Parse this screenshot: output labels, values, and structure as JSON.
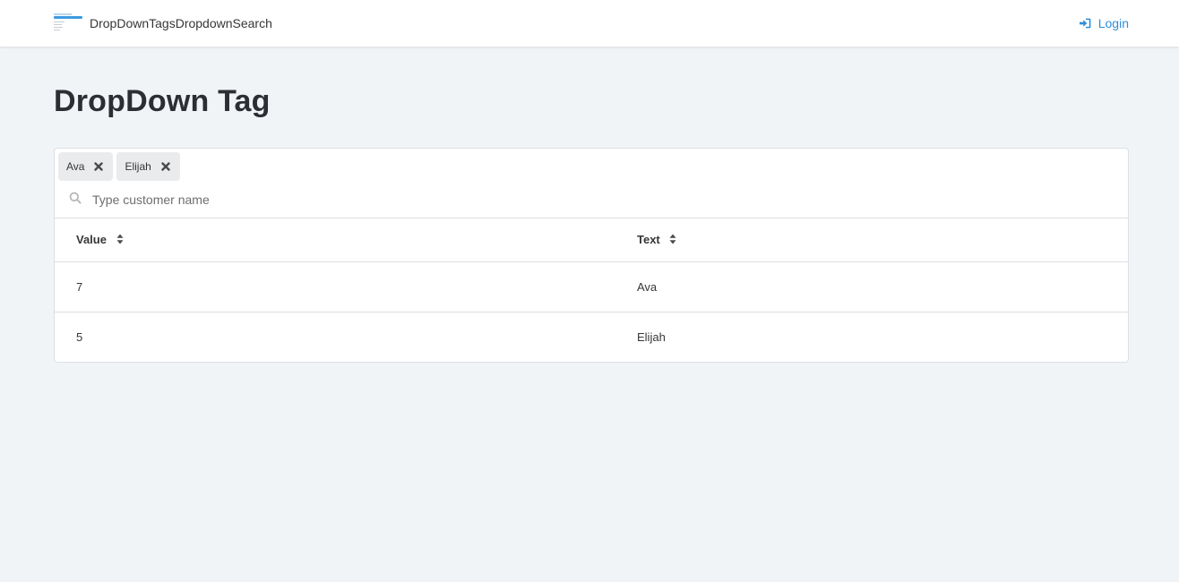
{
  "navbar": {
    "brand": "DropDownTagsDropdownSearch",
    "login_label": "Login",
    "accent_color": "#2f8ed8"
  },
  "page": {
    "title": "DropDown Tag"
  },
  "tags": [
    {
      "label": "Ava"
    },
    {
      "label": "Elijah"
    }
  ],
  "search": {
    "placeholder": "Type customer name",
    "value": ""
  },
  "table": {
    "columns": [
      "Value",
      "Text"
    ],
    "rows": [
      {
        "value": "7",
        "text": "Ava"
      },
      {
        "value": "5",
        "text": "Elijah"
      }
    ]
  },
  "icons": {
    "logo": "app-logo-icon",
    "login": "sign-in-icon",
    "tag_remove": "close-icon",
    "search": "search-icon",
    "sort": "sort-icon"
  }
}
